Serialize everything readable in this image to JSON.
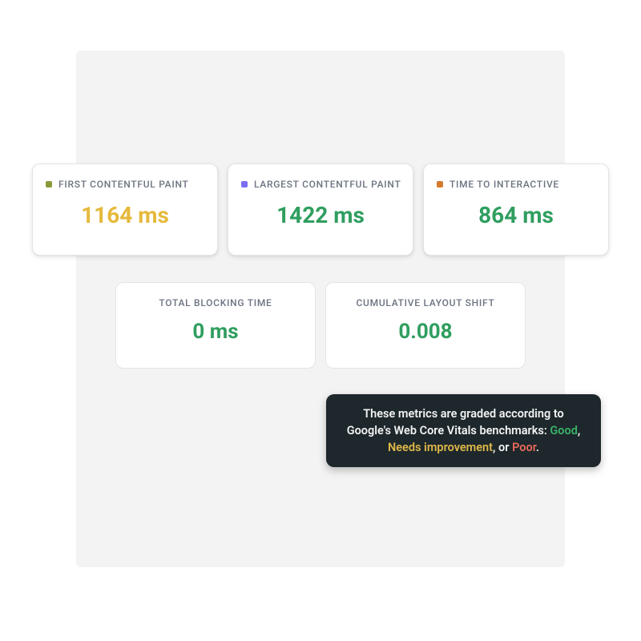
{
  "colors": {
    "good": "#2f9e5f",
    "warn": "#e6b93c",
    "poor": "#e05a4e",
    "swatch_olive": "#8a9a3b",
    "swatch_violet": "#7a6ff0",
    "swatch_orange": "#d67a2e"
  },
  "metrics": {
    "row1": [
      {
        "id": "fcp",
        "label": "FIRST CONTENTFUL PAINT",
        "value": "1164 ms",
        "swatch": "#8a9a3b",
        "status": "warn"
      },
      {
        "id": "lcp",
        "label": "LARGEST CONTENTFUL PAINT",
        "value": "1422 ms",
        "swatch": "#7a6ff0",
        "status": "good"
      },
      {
        "id": "tti",
        "label": "TIME TO INTERACTIVE",
        "value": "864 ms",
        "swatch": "#d67a2e",
        "status": "good"
      }
    ],
    "row2": [
      {
        "id": "tbt",
        "label": "TOTAL BLOCKING TIME",
        "value": "0 ms",
        "status": "good"
      },
      {
        "id": "cls",
        "label": "CUMULATIVE LAYOUT SHIFT",
        "value": "0.008",
        "status": "good"
      }
    ]
  },
  "tooltip": {
    "prefix": "These metrics are graded according to Google's Web Core Vitals benchmarks: ",
    "good": "Good",
    "sep1": ", ",
    "warn": "Needs improvement",
    "sep2": ", or ",
    "poor": "Poor",
    "suffix": "."
  }
}
